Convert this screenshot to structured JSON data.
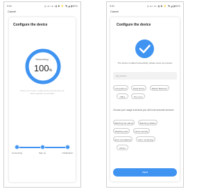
{
  "left_screen": {
    "status_bar": {
      "time": "9:31",
      "icons": "◎ ◂ ▪ ◂ •     ▮ ✱ ⚡ ◥ ◢ ▮66%"
    },
    "cancel_label": "Cancel",
    "card_title": "Configure the device",
    "progress": {
      "text": "Networking...",
      "value": "100",
      "unit": "%",
      "fraction": 1.0
    },
    "hint": "Place your router, mobile phone and devices as close together as possible.",
    "steps": [
      "Connecting",
      "Sign up",
      "Initialization"
    ]
  },
  "right_screen": {
    "status_bar": {
      "time": "9:31",
      "icons": "◎ ◂ ▪ ◂ •     ▮ ✱ ⚡ ◥ ◢ ▮66%"
    },
    "cancel_label": "Cancel",
    "card_title": "Configure the device",
    "success_message": "The device is added successfully, please name your device",
    "name_input_placeholder": "My device",
    "room_options": [
      "Living Room",
      "Study Room",
      "Master Bedroom",
      "Office",
      "The room"
    ],
    "usage_title": "Choose your usage scenarios you will more accurate services",
    "usage_options": [
      "Watching the elderly",
      "Watching children",
      "Watching pets",
      "Home security",
      "Store surveillance",
      "Farm monitoring",
      "Others"
    ],
    "next_label": "Next"
  },
  "colors": {
    "accent": "#3f93f1",
    "ring_track": "#e6f0fc",
    "card_shadow": "#d0d0d0"
  }
}
